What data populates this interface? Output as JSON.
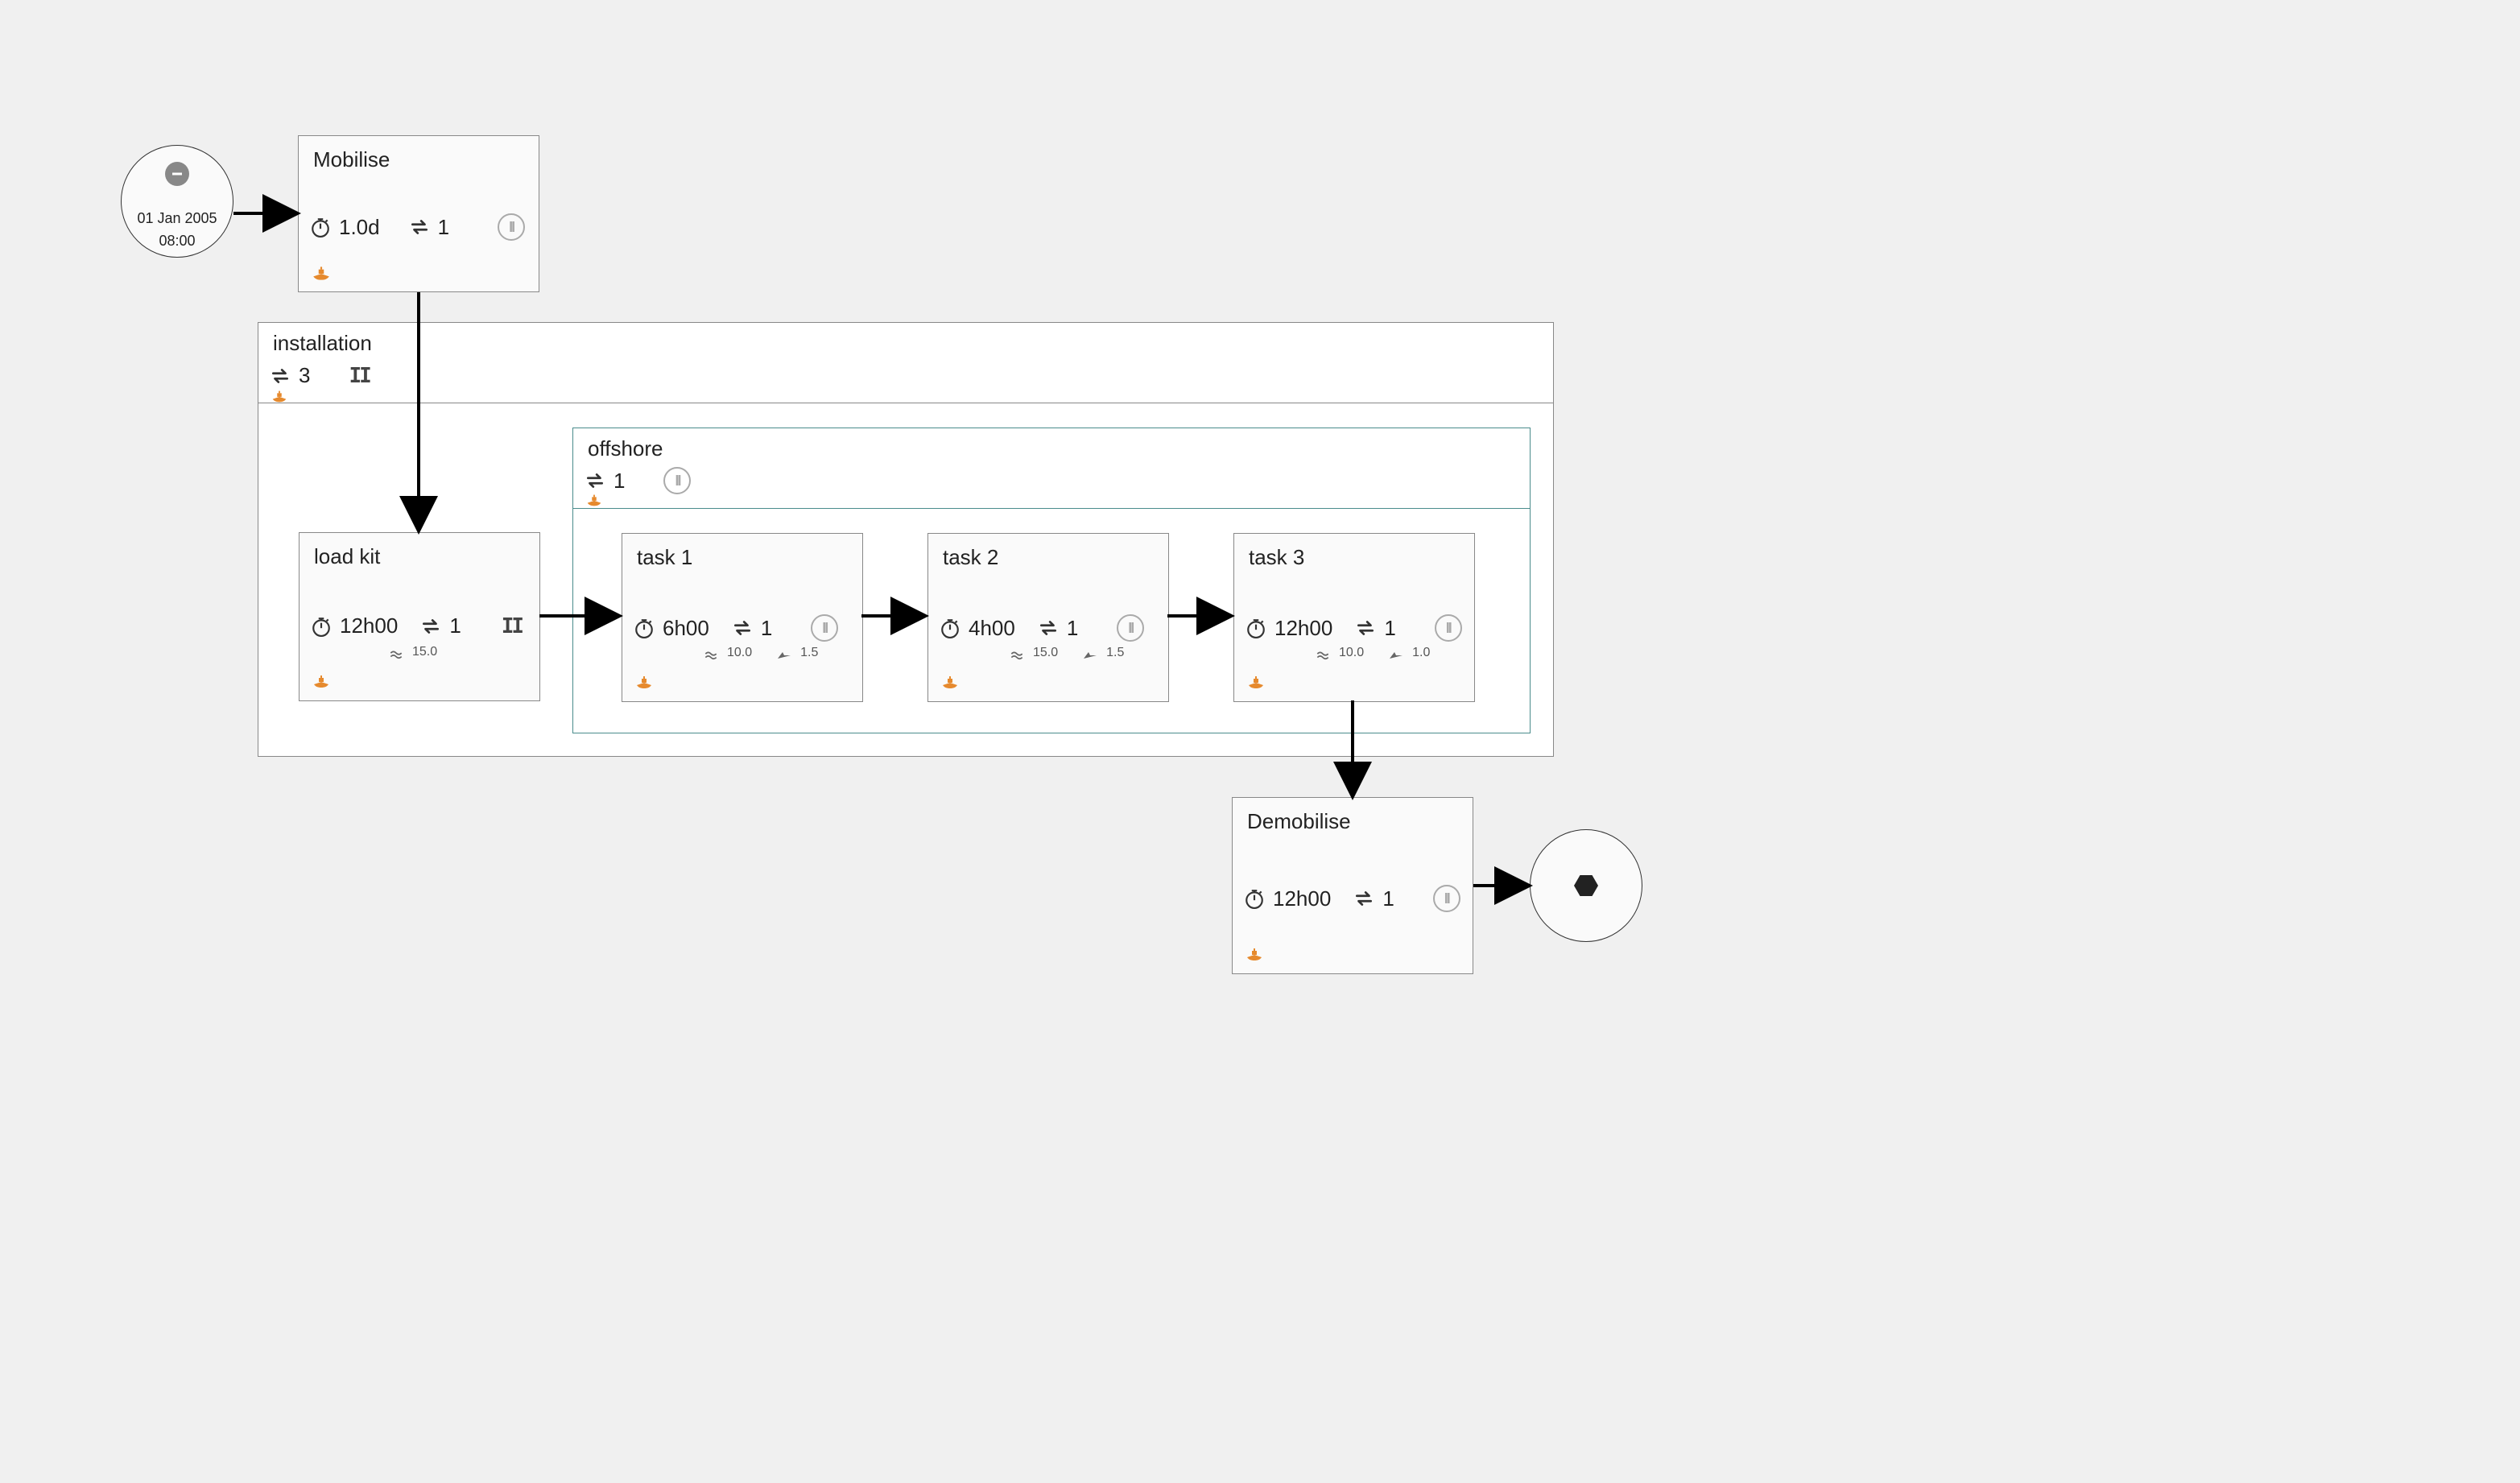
{
  "start": {
    "date": "01 Jan 2005",
    "time": "08:00"
  },
  "mobilise": {
    "title": "Mobilise",
    "duration": "1.0d",
    "loops": "1"
  },
  "installation": {
    "title": "installation",
    "loops": "3"
  },
  "loadkit": {
    "title": "load kit",
    "duration": "12h00",
    "loops": "1",
    "wind": "15.0"
  },
  "offshore": {
    "title": "offshore",
    "loops": "1"
  },
  "task1": {
    "title": "task 1",
    "duration": "6h00",
    "loops": "1",
    "wind": "10.0",
    "wave": "1.5"
  },
  "task2": {
    "title": "task 2",
    "duration": "4h00",
    "loops": "1",
    "wind": "15.0",
    "wave": "1.5"
  },
  "task3": {
    "title": "task 3",
    "duration": "12h00",
    "loops": "1",
    "wind": "10.0",
    "wave": "1.0"
  },
  "demobilise": {
    "title": "Demobilise",
    "duration": "12h00",
    "loops": "1"
  }
}
